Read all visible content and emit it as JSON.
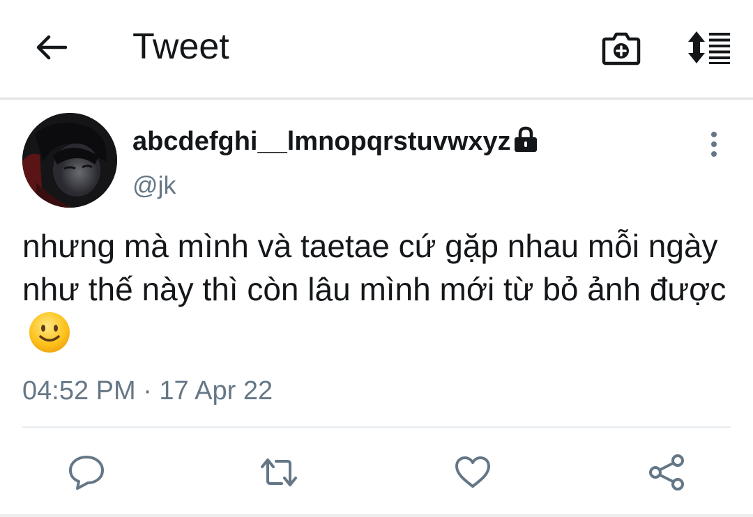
{
  "header": {
    "title": "Tweet",
    "back_icon": "arrow-left-icon",
    "camera_icon": "camera-plus-icon",
    "sort_icon": "sort-icon"
  },
  "tweet": {
    "display_name": "abcdefghi__lmnopqrstuvwxyz",
    "handle": "@jk",
    "protected_icon": "lock-icon",
    "more_icon": "more-vertical-icon",
    "text": "nhưng mà mình và taetae cứ gặp nhau mỗi ngày như thế này thì còn lâu mình mới từ bỏ ảnh được",
    "emoji": "slightly-smiling-face",
    "timestamp": "04:52 PM · 17 Apr 22"
  },
  "actions": {
    "reply_icon": "reply-icon",
    "retweet_icon": "retweet-icon",
    "like_icon": "heart-icon",
    "share_icon": "share-icon"
  },
  "colors": {
    "text_primary": "#14171a",
    "text_secondary": "#657786",
    "icon_gray": "#657786",
    "divider": "#e6ecf0",
    "background": "#ffffff"
  }
}
